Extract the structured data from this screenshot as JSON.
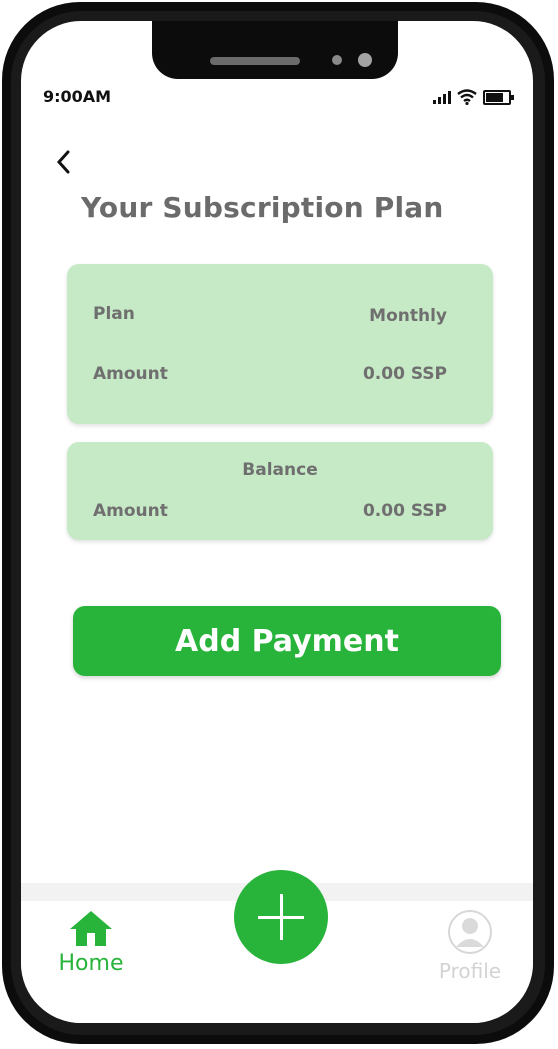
{
  "status_bar": {
    "time": "9:00AM"
  },
  "page": {
    "title": "Your Subscription Plan"
  },
  "plan_card": {
    "plan_label": "Plan",
    "plan_value": "Monthly",
    "amount_label": "Amount",
    "amount_value": "0.00 SSP"
  },
  "balance_card": {
    "title": "Balance",
    "amount_label": "Amount",
    "amount_value": "0.00 SSP"
  },
  "actions": {
    "add_payment_label": "Add Payment"
  },
  "bottom_nav": {
    "home_label": "Home",
    "profile_label": "Profile",
    "fab_icon": "plus-icon"
  },
  "colors": {
    "accent": "#28b33a",
    "card_bg": "#c6e9c6",
    "title_text": "#6b6b6b",
    "inactive_nav": "#d3d3d3"
  }
}
